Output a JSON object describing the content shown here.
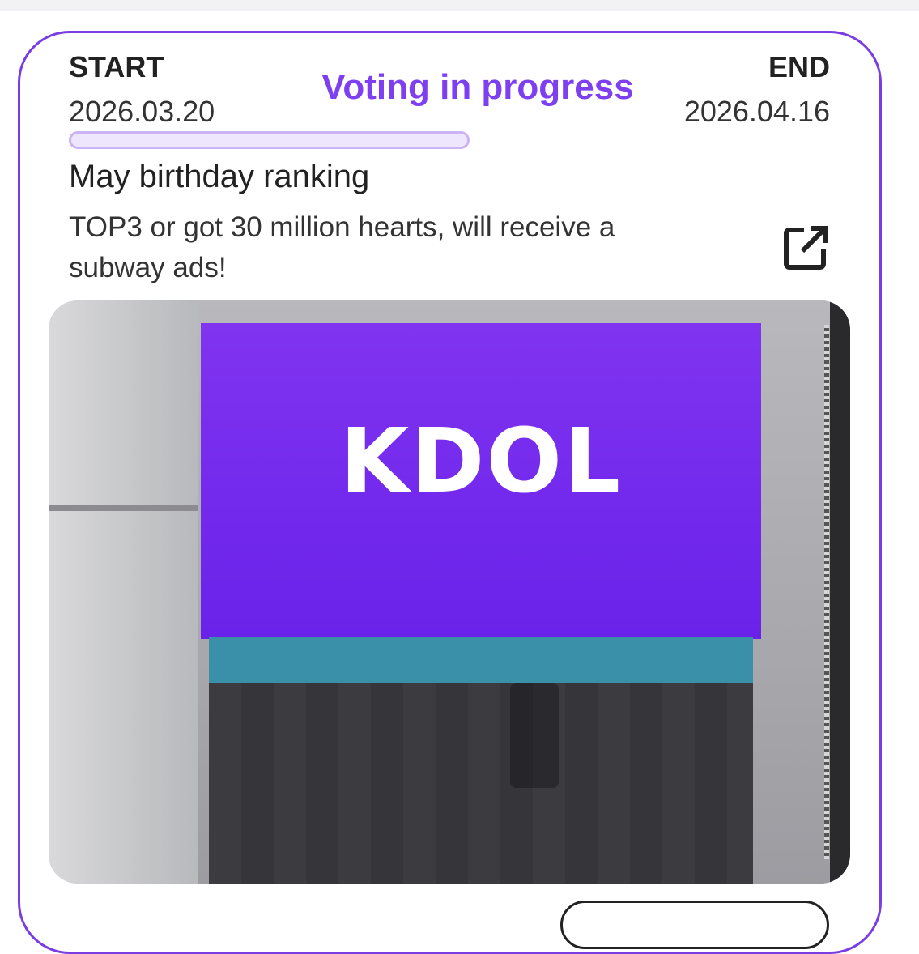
{
  "vote": {
    "start_label": "START",
    "start_date": "2026.03.20",
    "status": "Voting in progress",
    "end_label": "END",
    "end_date": "2026.04.16",
    "progress": 0,
    "title": "May birthday ranking",
    "description": "TOP3 or got 30 million hearts, will receive a subway ads!",
    "share_icon": "open-in-new-icon"
  },
  "banner": {
    "logo_text": "KDOL"
  },
  "colors": {
    "accent": "#7d3ff0",
    "card_border": "#7a3de2",
    "progress_track": "#eee6fc"
  }
}
